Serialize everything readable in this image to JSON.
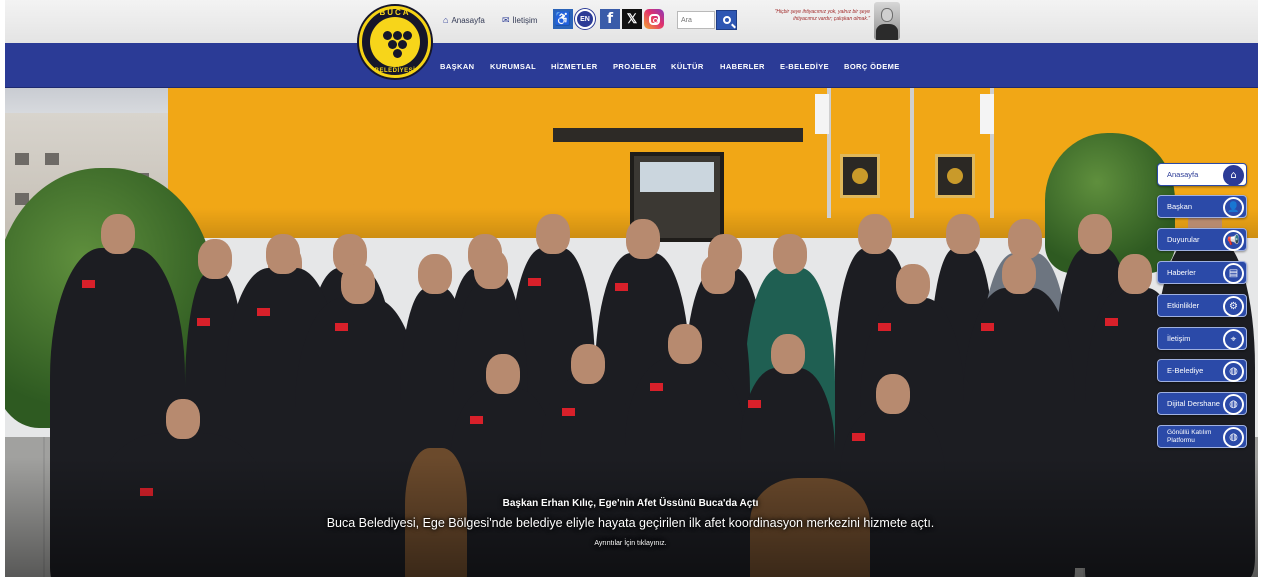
{
  "colors": {
    "nav_blue": "#2b3b96",
    "top_bar": "#ececec",
    "logo_yellow": "#f7d51a",
    "building_yellow": "#f1a716"
  },
  "header": {
    "logo": {
      "top_text": "BUCA",
      "bottom_text": "BELEDİYESİ",
      "icon": "grape-cluster-logo"
    },
    "top_links": [
      {
        "label": "Anasayfa",
        "icon": "home-icon"
      },
      {
        "label": "İletişim",
        "icon": "mail-icon"
      }
    ],
    "buttons": {
      "accessibility": "accessibility-icon",
      "language": "EN",
      "facebook": "f",
      "x": "𝕏",
      "instagram": "instagram-icon"
    },
    "search": {
      "placeholder": "Ara"
    },
    "quote": "\"Hiçbir şeye ihtiyacımız yok, yalnız bir şeye ihtiyacımız vardır; çalışkan olmak.\""
  },
  "nav": {
    "items": [
      "BAŞKAN",
      "KURUMSAL",
      "HİZMETLER",
      "PROJELER",
      "KÜLTÜR",
      "HABERLER",
      "E-BELEDİYE",
      "BORÇ ÖDEME"
    ]
  },
  "hero": {
    "title": "Başkan Erhan Kılıç, Ege'nin Afet Üssünü Buca'da Açtı",
    "description": "Buca Belediyesi, Ege Bölgesi'nde belediye eliyle hayata geçirilen ilk afet koordinasyon merkezini hizmete açtı.",
    "link_text": "Ayrıntılar İçin tıklayınız."
  },
  "side_menu": [
    {
      "label": "Anasayfa",
      "icon": "home-icon",
      "glyph": "⌂",
      "active": true
    },
    {
      "label": "Başkan",
      "icon": "user-icon",
      "glyph": "👤",
      "active": false
    },
    {
      "label": "Duyurular",
      "icon": "megaphone-icon",
      "glyph": "📢",
      "active": false
    },
    {
      "label": "Haberler",
      "icon": "newspaper-icon",
      "glyph": "▤",
      "active": false
    },
    {
      "label": "Etkinlikler",
      "icon": "gear-icon",
      "glyph": "⚙",
      "active": false
    },
    {
      "label": "İletişim",
      "icon": "location-pin-icon",
      "glyph": "⌖",
      "active": false
    },
    {
      "label": "E-Belediye",
      "icon": "globe-icon",
      "glyph": "◍",
      "active": false
    },
    {
      "label": "Dijital Dershane",
      "icon": "globe-icon",
      "glyph": "◍",
      "active": false
    },
    {
      "label": "Gönüllü Katılım Platformu",
      "icon": "globe-icon",
      "glyph": "◍",
      "active": false
    }
  ]
}
